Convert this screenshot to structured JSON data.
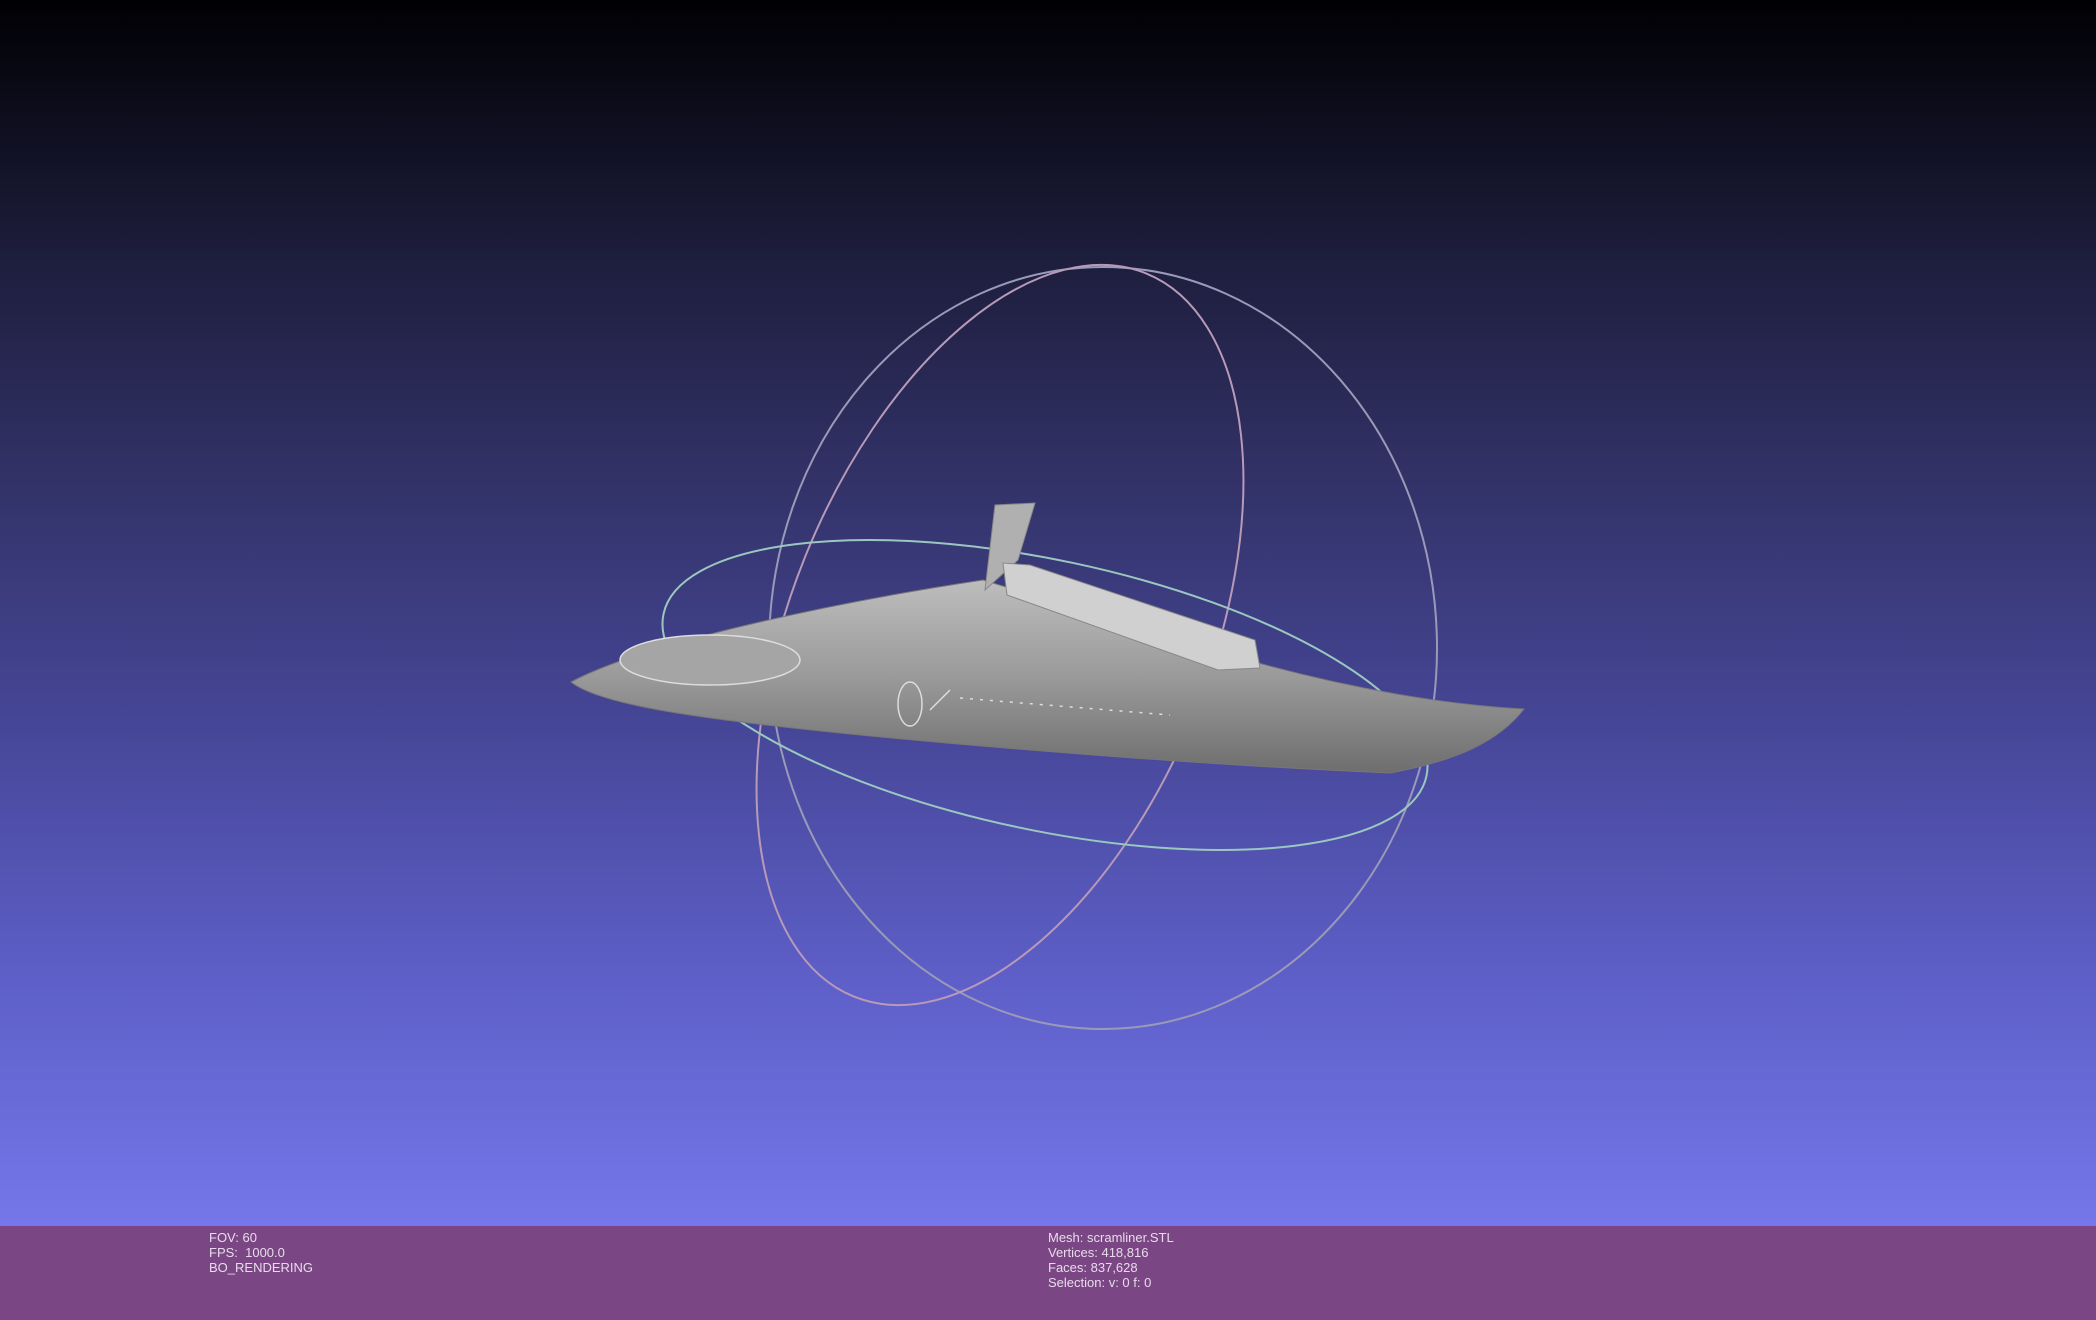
{
  "viewport": {
    "background_top": "#000003",
    "background_bottom": "#7577ea",
    "mesh_color": "#a8a8a8"
  },
  "status": {
    "left": {
      "fov": "FOV: 60",
      "fps": "FPS:  1000.0",
      "mode": "BO_RENDERING"
    },
    "right": {
      "mesh": "Mesh: scramliner.STL",
      "vertices": "Vertices: 418,816",
      "faces": "Faces: 837,628",
      "selection": "Selection: v: 0 f: 0"
    }
  }
}
